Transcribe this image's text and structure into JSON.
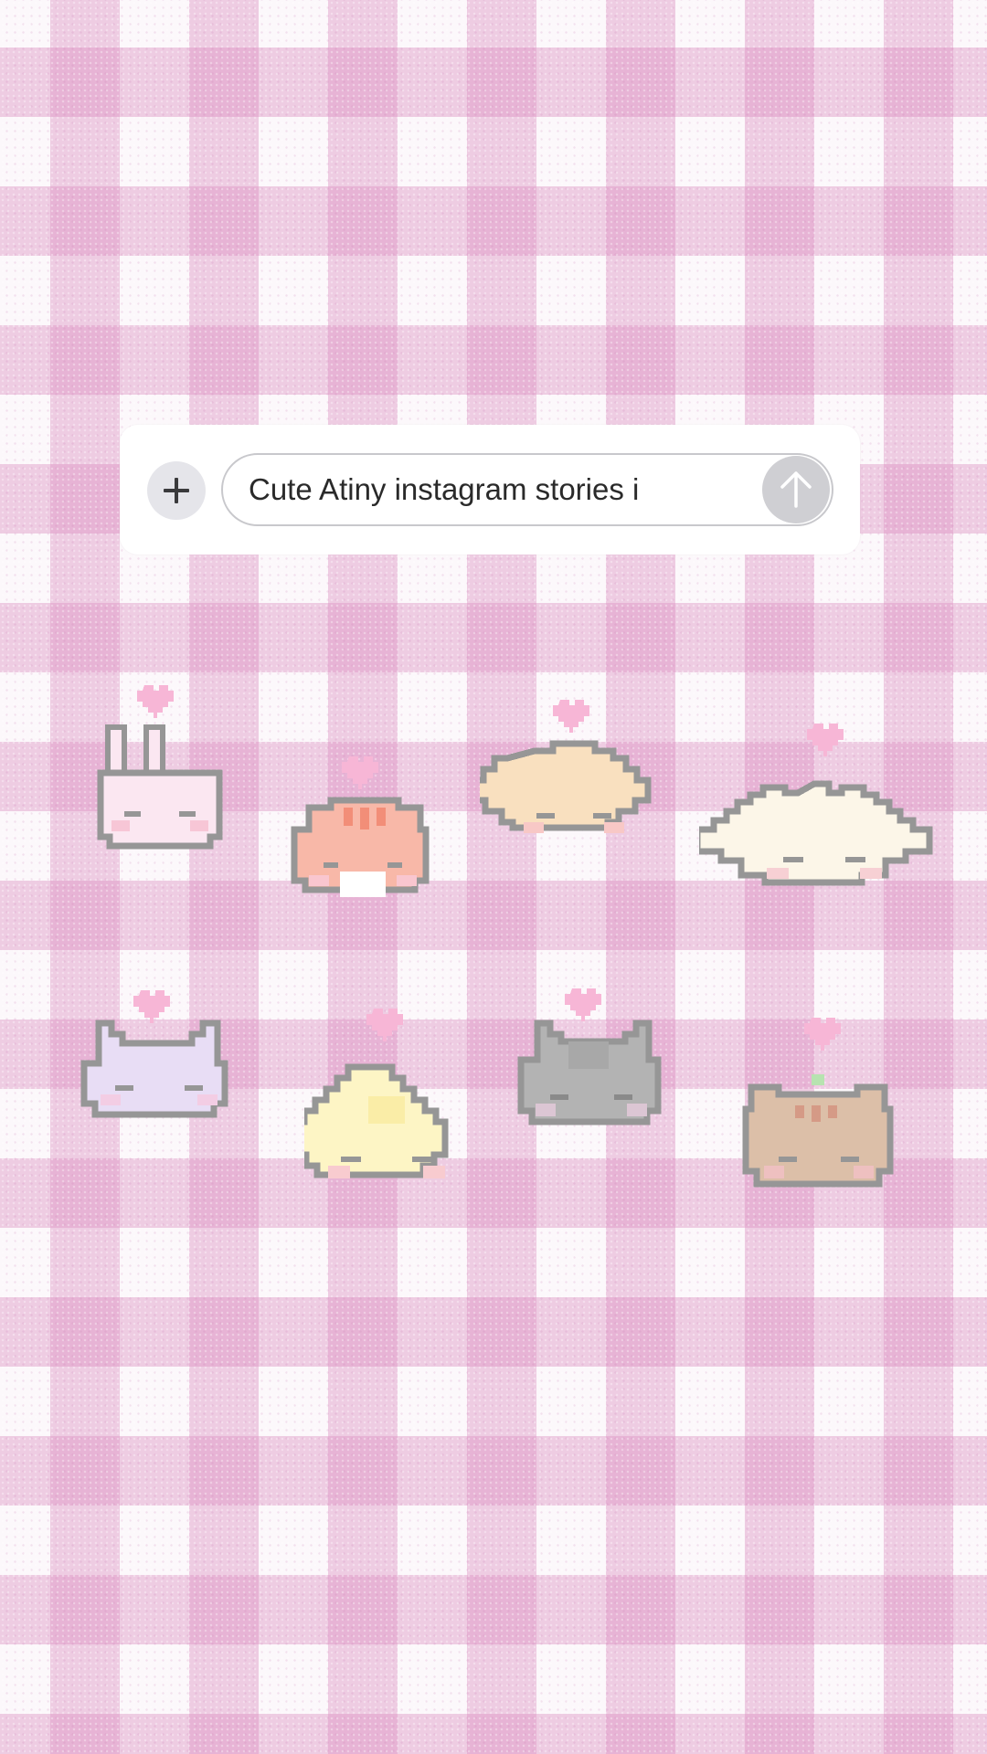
{
  "composer": {
    "message_text": "Cute Atiny instagram stories i",
    "add_icon": "plus-icon",
    "send_icon": "arrow-up-icon"
  },
  "stickers": [
    {
      "animal": "bunny",
      "color": "#fbe7f1"
    },
    {
      "animal": "hamster",
      "color": "#f8b8a8"
    },
    {
      "animal": "puppy",
      "color": "#f9e0bf"
    },
    {
      "animal": "sheep",
      "color": "#fcf6e8"
    },
    {
      "animal": "lavender-cat",
      "color": "#e8ddf5"
    },
    {
      "animal": "chick",
      "color": "#fdf5c5"
    },
    {
      "animal": "gray-cat",
      "color": "#b3b3b3"
    },
    {
      "animal": "brown-bear",
      "color": "#dcbfa8"
    }
  ]
}
